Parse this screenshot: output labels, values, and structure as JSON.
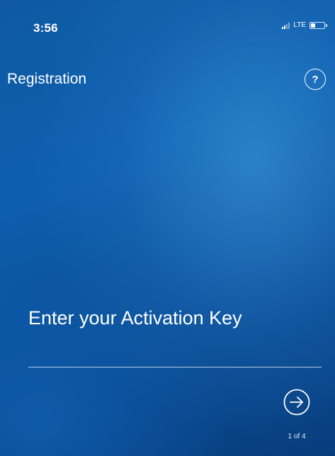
{
  "status_bar": {
    "time": "3:56",
    "network": "LTE",
    "signal_bars": 2,
    "battery_level": 0.35
  },
  "header": {
    "title": "Registration",
    "help_label": "?"
  },
  "main": {
    "prompt": "Enter your Activation Key",
    "activation_key_value": "",
    "step_indicator": "1 of 4"
  },
  "icons": {
    "next": "arrow-right-circle-icon",
    "help": "question-circle-icon"
  },
  "colors": {
    "background_primary": "#0d5fae",
    "background_dark": "#083d7d",
    "foreground": "#ffffff"
  }
}
